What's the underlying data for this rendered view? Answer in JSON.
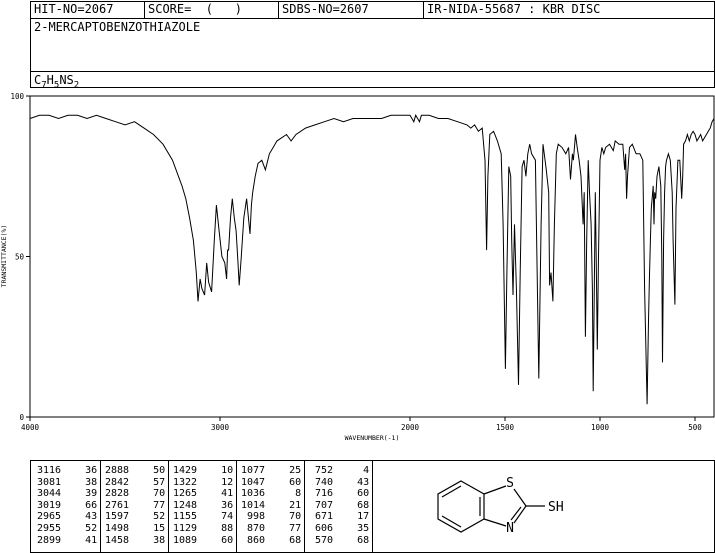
{
  "header": {
    "hit_no": "HIT-NO=2067",
    "score": "SCORE=  (   )",
    "sdbs_no": "SDBS-NO=2607",
    "ir_code": "IR-NIDA-55687 : KBR DISC",
    "compound": "2-MERCAPTOBENZOTHIAZOLE",
    "formula_parts": [
      "C",
      "7",
      "H",
      "5",
      "NS",
      "2"
    ]
  },
  "chart_data": {
    "type": "line",
    "xlabel": "WAVENUMBER(-1)",
    "ylabel": "TRANSMITTANCE(%)",
    "xlim": [
      4000,
      400
    ],
    "ylim": [
      0,
      100
    ],
    "xticks": [
      4000,
      3000,
      2000,
      1500,
      1000,
      500
    ],
    "yticks": [
      0,
      50,
      100
    ],
    "grid": false,
    "series": [
      {
        "points": [
          [
            4000,
            93
          ],
          [
            3950,
            94
          ],
          [
            3900,
            94
          ],
          [
            3850,
            93
          ],
          [
            3800,
            94
          ],
          [
            3750,
            94
          ],
          [
            3700,
            93
          ],
          [
            3650,
            94
          ],
          [
            3600,
            93
          ],
          [
            3550,
            92
          ],
          [
            3500,
            91
          ],
          [
            3450,
            92
          ],
          [
            3400,
            90
          ],
          [
            3350,
            88
          ],
          [
            3300,
            85
          ],
          [
            3250,
            80
          ],
          [
            3200,
            72
          ],
          [
            3180,
            68
          ],
          [
            3160,
            62
          ],
          [
            3140,
            55
          ],
          [
            3125,
            45
          ],
          [
            3116,
            36
          ],
          [
            3105,
            43
          ],
          [
            3095,
            40
          ],
          [
            3081,
            38
          ],
          [
            3070,
            48
          ],
          [
            3060,
            42
          ],
          [
            3044,
            39
          ],
          [
            3030,
            55
          ],
          [
            3019,
            66
          ],
          [
            3005,
            58
          ],
          [
            2990,
            50
          ],
          [
            2975,
            48
          ],
          [
            2965,
            43
          ],
          [
            2960,
            52
          ],
          [
            2955,
            52
          ],
          [
            2945,
            62
          ],
          [
            2935,
            68
          ],
          [
            2925,
            62
          ],
          [
            2915,
            58
          ],
          [
            2905,
            48
          ],
          [
            2899,
            41
          ],
          [
            2888,
            50
          ],
          [
            2875,
            62
          ],
          [
            2860,
            68
          ],
          [
            2842,
            57
          ],
          [
            2835,
            66
          ],
          [
            2828,
            70
          ],
          [
            2815,
            75
          ],
          [
            2800,
            79
          ],
          [
            2780,
            80
          ],
          [
            2761,
            77
          ],
          [
            2740,
            82
          ],
          [
            2720,
            84
          ],
          [
            2700,
            86
          ],
          [
            2650,
            88
          ],
          [
            2626,
            86
          ],
          [
            2600,
            88
          ],
          [
            2550,
            90
          ],
          [
            2500,
            91
          ],
          [
            2450,
            92
          ],
          [
            2400,
            93
          ],
          [
            2350,
            92
          ],
          [
            2300,
            93
          ],
          [
            2250,
            93
          ],
          [
            2200,
            93
          ],
          [
            2150,
            93
          ],
          [
            2100,
            94
          ],
          [
            2050,
            94
          ],
          [
            2000,
            94
          ],
          [
            1980,
            92
          ],
          [
            1970,
            94
          ],
          [
            1950,
            92
          ],
          [
            1940,
            94
          ],
          [
            1900,
            94
          ],
          [
            1850,
            93
          ],
          [
            1800,
            93
          ],
          [
            1750,
            92
          ],
          [
            1700,
            91
          ],
          [
            1680,
            90
          ],
          [
            1660,
            91
          ],
          [
            1640,
            89
          ],
          [
            1620,
            90
          ],
          [
            1605,
            80
          ],
          [
            1597,
            52
          ],
          [
            1590,
            75
          ],
          [
            1580,
            88
          ],
          [
            1560,
            89
          ],
          [
            1540,
            86
          ],
          [
            1520,
            82
          ],
          [
            1510,
            60
          ],
          [
            1498,
            15
          ],
          [
            1490,
            45
          ],
          [
            1480,
            78
          ],
          [
            1470,
            75
          ],
          [
            1465,
            55
          ],
          [
            1458,
            38
          ],
          [
            1450,
            60
          ],
          [
            1440,
            40
          ],
          [
            1429,
            10
          ],
          [
            1420,
            45
          ],
          [
            1410,
            78
          ],
          [
            1400,
            80
          ],
          [
            1390,
            75
          ],
          [
            1380,
            82
          ],
          [
            1370,
            85
          ],
          [
            1360,
            82
          ],
          [
            1340,
            80
          ],
          [
            1322,
            12
          ],
          [
            1310,
            60
          ],
          [
            1300,
            85
          ],
          [
            1285,
            78
          ],
          [
            1270,
            70
          ],
          [
            1265,
            41
          ],
          [
            1258,
            45
          ],
          [
            1248,
            36
          ],
          [
            1240,
            60
          ],
          [
            1230,
            82
          ],
          [
            1220,
            85
          ],
          [
            1200,
            84
          ],
          [
            1180,
            82
          ],
          [
            1165,
            84
          ],
          [
            1155,
            74
          ],
          [
            1145,
            82
          ],
          [
            1140,
            80
          ],
          [
            1129,
            88
          ],
          [
            1120,
            84
          ],
          [
            1110,
            80
          ],
          [
            1100,
            75
          ],
          [
            1089,
            60
          ],
          [
            1083,
            70
          ],
          [
            1077,
            25
          ],
          [
            1070,
            55
          ],
          [
            1062,
            80
          ],
          [
            1055,
            70
          ],
          [
            1047,
            60
          ],
          [
            1040,
            40
          ],
          [
            1036,
            8
          ],
          [
            1030,
            40
          ],
          [
            1025,
            70
          ],
          [
            1020,
            50
          ],
          [
            1014,
            21
          ],
          [
            1008,
            50
          ],
          [
            1000,
            80
          ],
          [
            990,
            84
          ],
          [
            980,
            82
          ],
          [
            970,
            84
          ],
          [
            950,
            85
          ],
          [
            930,
            83
          ],
          [
            920,
            86
          ],
          [
            900,
            85
          ],
          [
            880,
            85
          ],
          [
            870,
            77
          ],
          [
            865,
            82
          ],
          [
            860,
            68
          ],
          [
            855,
            75
          ],
          [
            845,
            84
          ],
          [
            830,
            85
          ],
          [
            810,
            82
          ],
          [
            790,
            82
          ],
          [
            775,
            80
          ],
          [
            765,
            40
          ],
          [
            752,
            4
          ],
          [
            745,
            30
          ],
          [
            740,
            43
          ],
          [
            735,
            55
          ],
          [
            730,
            65
          ],
          [
            720,
            72
          ],
          [
            716,
            60
          ],
          [
            712,
            70
          ],
          [
            707,
            68
          ],
          [
            700,
            75
          ],
          [
            690,
            78
          ],
          [
            680,
            72
          ],
          [
            675,
            50
          ],
          [
            671,
            17
          ],
          [
            665,
            55
          ],
          [
            660,
            70
          ],
          [
            655,
            78
          ],
          [
            650,
            80
          ],
          [
            640,
            82
          ],
          [
            630,
            80
          ],
          [
            620,
            70
          ],
          [
            615,
            55
          ],
          [
            606,
            35
          ],
          [
            600,
            65
          ],
          [
            590,
            80
          ],
          [
            580,
            80
          ],
          [
            570,
            68
          ],
          [
            565,
            75
          ],
          [
            560,
            85
          ],
          [
            550,
            86
          ],
          [
            540,
            88
          ],
          [
            530,
            86
          ],
          [
            520,
            88
          ],
          [
            510,
            89
          ],
          [
            500,
            88
          ],
          [
            490,
            86
          ],
          [
            480,
            87
          ],
          [
            470,
            88
          ],
          [
            460,
            86
          ],
          [
            450,
            87
          ],
          [
            440,
            88
          ],
          [
            430,
            89
          ],
          [
            420,
            90
          ],
          [
            410,
            92
          ],
          [
            400,
            93
          ]
        ]
      }
    ]
  },
  "peak_table": [
    [
      [
        3116,
        36
      ],
      [
        3081,
        38
      ],
      [
        3044,
        39
      ],
      [
        3019,
        66
      ],
      [
        2965,
        43
      ],
      [
        2955,
        52
      ],
      [
        2899,
        41
      ]
    ],
    [
      [
        2888,
        50
      ],
      [
        2842,
        57
      ],
      [
        2828,
        70
      ],
      [
        2761,
        77
      ],
      [
        1597,
        52
      ],
      [
        1498,
        15
      ],
      [
        1458,
        38
      ]
    ],
    [
      [
        1429,
        10
      ],
      [
        1322,
        12
      ],
      [
        1265,
        41
      ],
      [
        1248,
        36
      ],
      [
        1155,
        74
      ],
      [
        1129,
        88
      ],
      [
        1089,
        60
      ]
    ],
    [
      [
        1077,
        25
      ],
      [
        1047,
        60
      ],
      [
        1036,
        8
      ],
      [
        1014,
        21
      ],
      [
        998,
        70
      ],
      [
        870,
        77
      ],
      [
        860,
        68
      ]
    ],
    [
      [
        752,
        4
      ],
      [
        740,
        43
      ],
      [
        716,
        60
      ],
      [
        707,
        68
      ],
      [
        671,
        17
      ],
      [
        606,
        35
      ],
      [
        570,
        68
      ]
    ]
  ],
  "structure": {
    "atom_s": "S",
    "atom_n": "N",
    "group_sh": "SH"
  }
}
